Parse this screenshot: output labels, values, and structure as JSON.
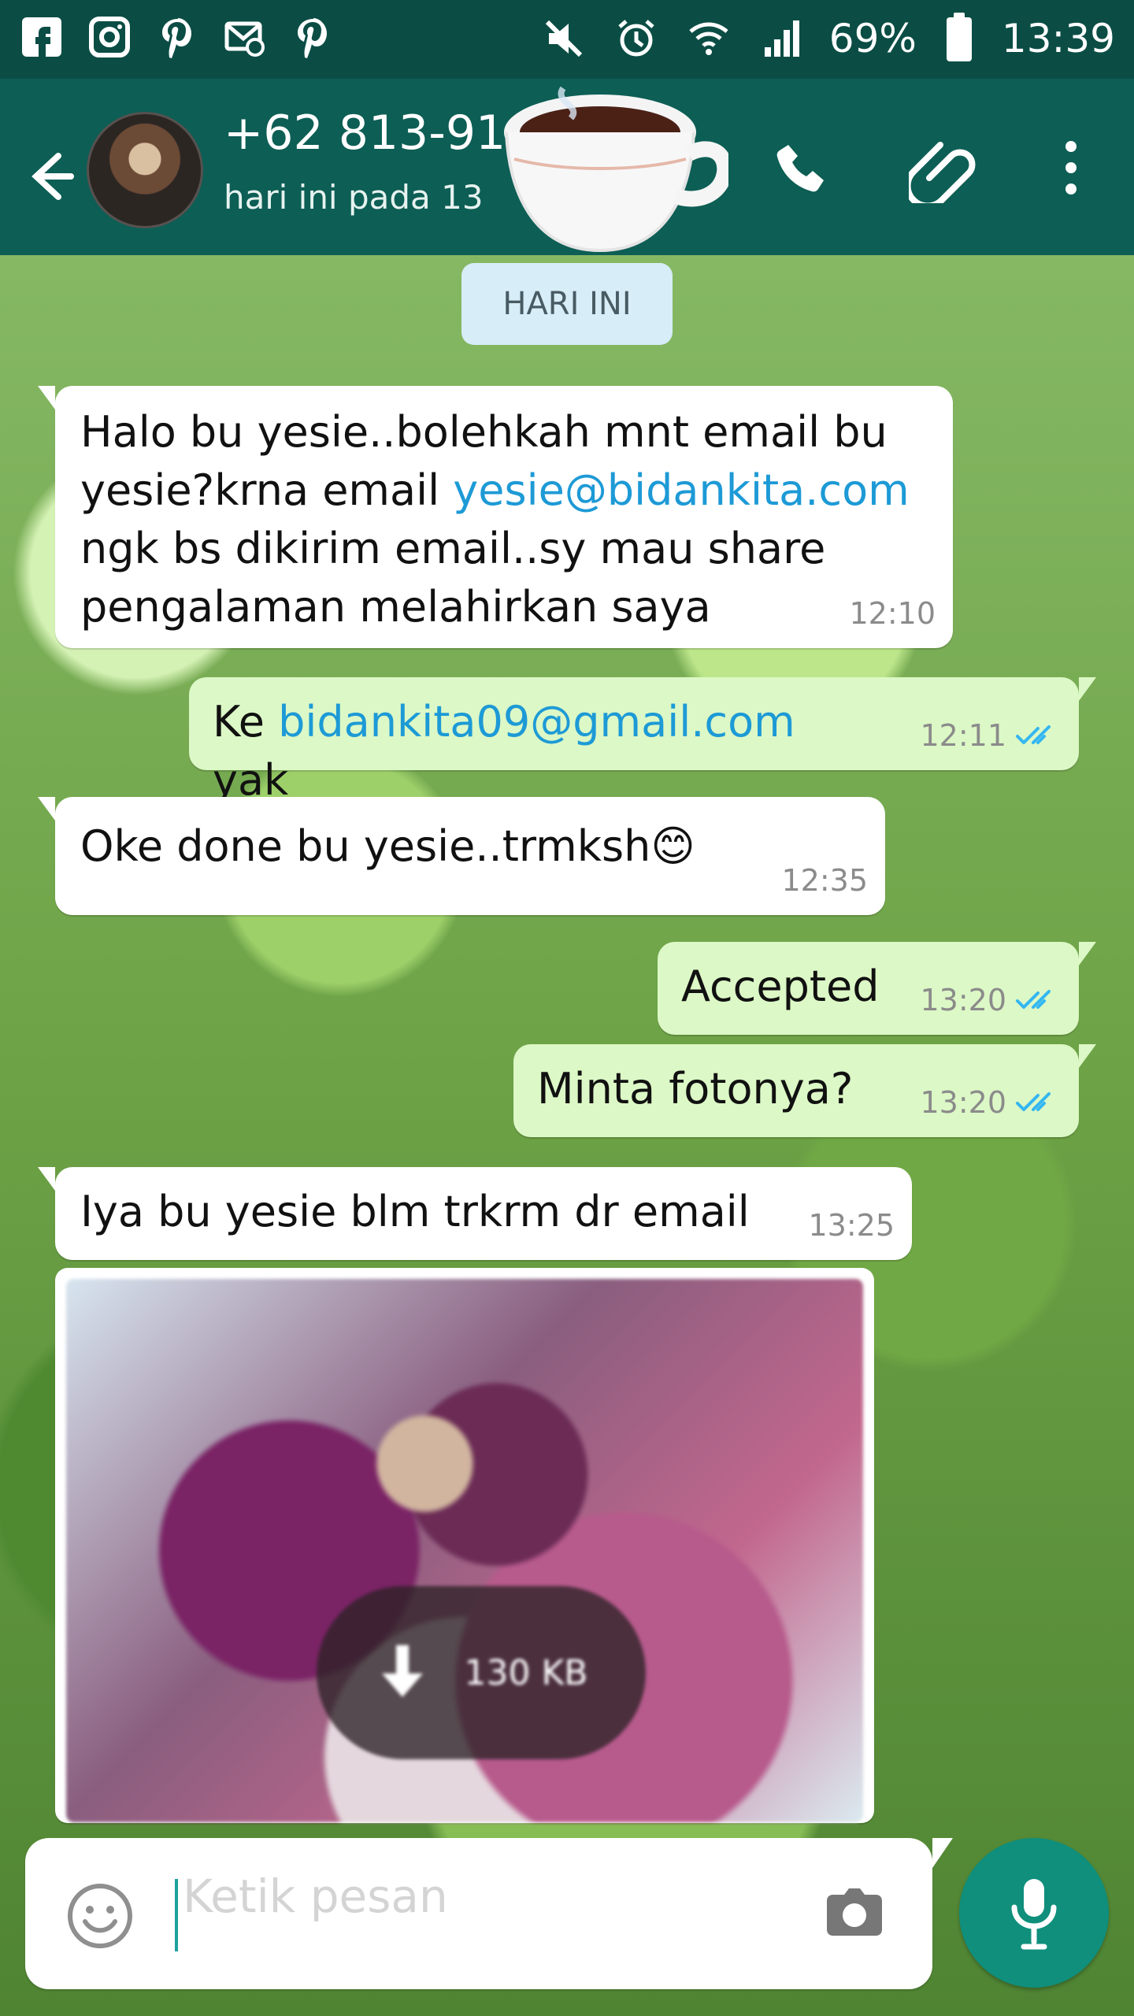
{
  "colors": {
    "status_bar": "#0b4d45",
    "header": "#0d5e55",
    "link": "#1d9ad6",
    "outgoing_bubble": "#dcf8c6",
    "incoming_bubble": "#ffffff",
    "mic_button": "#0f8f7c"
  },
  "status_bar": {
    "battery_percent": "69%",
    "time": "13:39"
  },
  "header": {
    "contact_name": "+62 813-91",
    "contact_status": "hari ini pada 13"
  },
  "chat": {
    "date_chip": "HARI INI",
    "messages": [
      {
        "id": "m1",
        "direction": "incoming",
        "text_before": "Halo bu yesie..bolehkah mnt email bu\nyesie?krna email ",
        "link": "yesie@bidankita.com",
        "text_after": "\nngk bs dikirim email..sy mau share\npengalaman melahirkan saya",
        "time": "12:10"
      },
      {
        "id": "m2",
        "direction": "outgoing",
        "text_before": "Ke ",
        "link": "bidankita09@gmail.com",
        "text_after": " yak",
        "time": "12:11"
      },
      {
        "id": "m3",
        "direction": "incoming",
        "text": "Oke done bu yesie..trmksh😊",
        "time": "12:35"
      },
      {
        "id": "m4",
        "direction": "outgoing",
        "text": "Accepted",
        "time": "13:20"
      },
      {
        "id": "m5",
        "direction": "outgoing",
        "text": "Minta fotonya?",
        "time": "13:20"
      },
      {
        "id": "m6",
        "direction": "incoming",
        "text": "Iya bu yesie blm trkrm dr email",
        "time": "13:25"
      }
    ],
    "attachment": {
      "size": "130 KB"
    }
  },
  "composer": {
    "placeholder": "Ketik pesan"
  }
}
